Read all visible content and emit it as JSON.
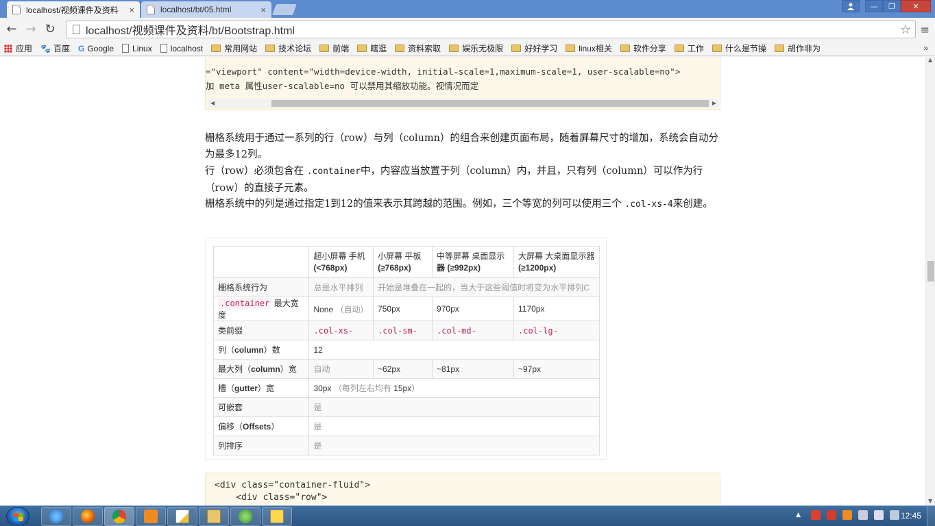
{
  "browser": {
    "tabs": [
      {
        "label": "localhost/视频课件及资料",
        "close": "×",
        "active": true
      },
      {
        "label": "localhost/bt/05.html",
        "close": "×",
        "active": false
      }
    ],
    "address": "localhost/视频课件及资料/bt/Bootstrap.html",
    "nav": {
      "back": "←",
      "forward": "→",
      "reload": "↻",
      "star": "☆",
      "menu": "≡"
    },
    "window_buttons": {
      "minimize": "—",
      "restore": "❐",
      "close": "✕"
    },
    "bookmarks": [
      {
        "label": "应用",
        "icon": "apps-icon"
      },
      {
        "label": "百度",
        "icon": "baidu-icon"
      },
      {
        "label": "Google",
        "icon": "google-icon"
      },
      {
        "label": "Linux",
        "icon": "page-icon"
      },
      {
        "label": "localhost",
        "icon": "page-icon"
      },
      {
        "label": "常用网站",
        "icon": "folder-icon"
      },
      {
        "label": "技术论坛",
        "icon": "folder-icon"
      },
      {
        "label": "前端",
        "icon": "folder-icon"
      },
      {
        "label": "瞎逛",
        "icon": "folder-icon"
      },
      {
        "label": "资料索取",
        "icon": "folder-icon"
      },
      {
        "label": "娱乐无极限",
        "icon": "folder-icon"
      },
      {
        "label": "好好学习",
        "icon": "folder-icon"
      },
      {
        "label": "linux相关",
        "icon": "folder-icon"
      },
      {
        "label": "软件分享",
        "icon": "folder-icon"
      },
      {
        "label": "工作",
        "icon": "folder-icon"
      },
      {
        "label": "什么是节操",
        "icon": "folder-icon"
      },
      {
        "label": "胡作非为",
        "icon": "folder-icon"
      }
    ],
    "bookmarks_more": "»"
  },
  "page": {
    "code1": {
      "line1": "=\"viewport\" content=\"width=device-width, initial-scale=1,maximum-scale=1, user-scalable=no\">",
      "line2": "加 meta 属性user-scalable=no 可以禁用其缩放功能。视情况而定"
    },
    "para1": "栅格系统用于通过一系列的行（row）与列（column）的组合来创建页面布局，随着屏幕尺寸的增加，系统会自动分为最多12列。",
    "para2_prefix": "行（row）必须包含在 ",
    "para2_code": ".container",
    "para2_suffix": "中，内容应当放置于列（column）内，并且，只有列（column）可以作为行（row）的直接子元素。",
    "para3_prefix": "栅格系统中的列是通过指定1到12的值来表示其跨越的范围。例如，三个等宽的列可以使用三个 ",
    "para3_code": ".col-xs-4",
    "para3_suffix": "来创建。",
    "table": {
      "headers": [
        {
          "top": "",
          "bottom": ""
        },
        {
          "top": "超小屏幕 手机",
          "bottom": "(<768px)"
        },
        {
          "top": "小屏幕 平板",
          "bottom": "(≥768px)"
        },
        {
          "top": "中等屏幕 桌面显示",
          "bottom": "器 (≥992px)"
        },
        {
          "top": "大屏幕 大桌面显示器",
          "bottom": "(≥1200px)"
        }
      ],
      "rows": {
        "behavior": {
          "label": "栅格系统行为",
          "xs": "总是水平排列",
          "rest": "开始是堆叠在一起的，当大于这些阈值时将变为水平排列C"
        },
        "container": {
          "label_code": ".container",
          "label_text": " 最大宽度",
          "xs_main": "None",
          "xs_note": "（自动）",
          "sm": "750px",
          "md": "970px",
          "lg": "1170px"
        },
        "prefix": {
          "label": "类前缀",
          "xs": ".col-xs-",
          "sm": ".col-sm-",
          "md": ".col-md-",
          "lg": ".col-lg-"
        },
        "columns": {
          "label_a": "列（",
          "label_b": "column",
          "label_c": "）数",
          "value": "12"
        },
        "max_col": {
          "label_a": "最大列（",
          "label_b": "column",
          "label_c": "）宽",
          "xs": "自动",
          "sm": "~62px",
          "md": "~81px",
          "lg": "~97px"
        },
        "gutter": {
          "label_a": "槽（",
          "label_b": "gutter",
          "label_c": "）宽",
          "main": "30px",
          "note_a": "（每列左右均有 ",
          "note_b": "15px",
          "note_c": "）"
        },
        "nestable": {
          "label": "可嵌套",
          "value": "是"
        },
        "offsets": {
          "label_a": "偏移（",
          "label_b": "Offsets",
          "label_c": "）",
          "value": "是"
        },
        "ordering": {
          "label": "列排序",
          "value": "是"
        }
      }
    },
    "code2": {
      "line1": "<div class=\"container-fluid\">",
      "line2": "    <div class=\"row\">"
    }
  },
  "taskbar": {
    "clock": "12:45",
    "apps": [
      "ie-icon",
      "firefox-icon",
      "chrome-icon",
      "app-orange-icon",
      "notepad-icon",
      "explorer-icon",
      "app-green-icon",
      "help-icon"
    ]
  }
}
